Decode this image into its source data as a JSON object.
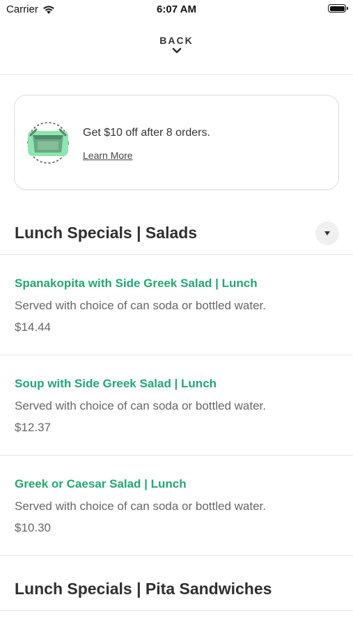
{
  "status_bar": {
    "carrier": "Carrier",
    "time": "6:07 AM"
  },
  "header": {
    "back_label": "BACK"
  },
  "promo": {
    "text": "Get $10 off after 8 orders.",
    "link": "Learn More",
    "icon": "takeout-box-icon"
  },
  "sections": [
    {
      "title": "Lunch Specials | Salads",
      "items": [
        {
          "name": "Spanakopita with Side Greek Salad | Lunch",
          "description": "Served with choice of can soda or bottled water.",
          "price": "$14.44"
        },
        {
          "name": "Soup with Side Greek Salad | Lunch",
          "description": "Served with choice of can soda or bottled water.",
          "price": "$12.37"
        },
        {
          "name": "Greek or Caesar Salad | Lunch",
          "description": "Served with choice of can soda or bottled water.",
          "price": "$10.30"
        }
      ]
    },
    {
      "title": "Lunch Specials | Pita Sandwiches"
    }
  ],
  "colors": {
    "accent": "#22a772",
    "text": "#333333",
    "muted": "#666666",
    "divider": "#e6e6e6"
  }
}
